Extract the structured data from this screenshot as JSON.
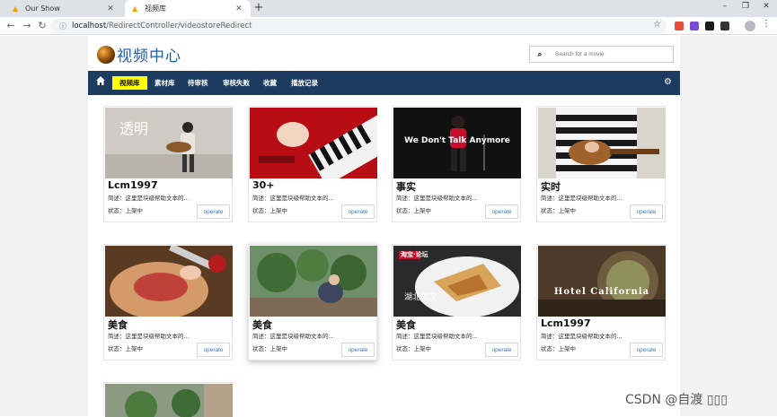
{
  "browser": {
    "tabs": [
      {
        "title": "Our Show",
        "active": false
      },
      {
        "title": "视频库",
        "active": true
      }
    ],
    "url_host": "localhost",
    "url_path": "/RedirectController/videostoreRedirect"
  },
  "header": {
    "site_title": "视频中心",
    "search_placeholder": "Search for a movie"
  },
  "nav": {
    "items": [
      {
        "label": "视频库",
        "active": true
      },
      {
        "label": "素材库",
        "active": false
      },
      {
        "label": "待审核",
        "active": false
      },
      {
        "label": "审核失败",
        "active": false
      },
      {
        "label": "收藏",
        "active": false
      },
      {
        "label": "播放记录",
        "active": false
      }
    ]
  },
  "videos": [
    {
      "title": "Lcm1997",
      "desc": "简述：这里是块级帮助文本的...",
      "status": "状态：上架中",
      "button": "operate",
      "overlay": "透明"
    },
    {
      "title": "30+",
      "desc": "简述：这里是块级帮助文本的...",
      "status": "状态：上架中",
      "button": "operate",
      "overlay": ""
    },
    {
      "title": "事实",
      "desc": "简述：这里是块级帮助文本的...",
      "status": "状态：上架中",
      "button": "operate",
      "overlay": "We Don't Talk Anymore"
    },
    {
      "title": "实时",
      "desc": "简述：这里是块级帮助文本的...",
      "status": "状态：上架中",
      "button": "operate",
      "overlay": ""
    },
    {
      "title": "美食",
      "desc": "简述：这里是块级帮助文本的...",
      "status": "状态：上架中",
      "button": "operate",
      "overlay": ""
    },
    {
      "title": "美食",
      "desc": "简述：这里是块级帮助文本的...",
      "status": "状态：上架中",
      "button": "operate",
      "overlay": ""
    },
    {
      "title": "美食",
      "desc": "简述：这里是块级帮助文本的...",
      "status": "状态：上架中",
      "button": "operate",
      "overlay": "湖北武汉"
    },
    {
      "title": "Lcm1997",
      "desc": "简述：这里是块级帮助文本的...",
      "status": "状态：上架中",
      "button": "operate",
      "overlay": "Hotel California"
    }
  ],
  "watermark": "CSDN @自渡 ▯▯▯"
}
